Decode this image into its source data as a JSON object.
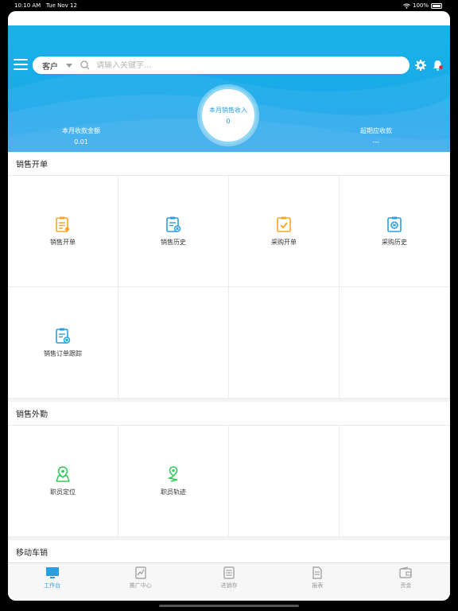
{
  "status": {
    "time": "10:10 AM",
    "date": "Tue Nov 12",
    "battery": "100%"
  },
  "header": {
    "search_scope": "客户",
    "search_placeholder": "请输入关键字..."
  },
  "summary": {
    "center_label": "本月销售收入",
    "center_value": "0",
    "left_label": "本月收款金额",
    "left_value": "0.01",
    "right_label": "超期应收款",
    "right_value": "---"
  },
  "sections": [
    {
      "title": "销售开单",
      "items": [
        "销售开单",
        "销售历史",
        "采购开单",
        "采购历史",
        "销售订单跟踪"
      ]
    },
    {
      "title": "销售外勤",
      "items": [
        "职员定位",
        "职员轨迹"
      ]
    },
    {
      "title": "移动车销",
      "items": []
    }
  ],
  "tabs": [
    "工作台",
    "推广中心",
    "进销存",
    "报表",
    "资金"
  ],
  "colors": {
    "accent": "#2a9fe0",
    "orange": "#f5a623",
    "green": "#34c759",
    "hero": "#1aa8ea"
  }
}
